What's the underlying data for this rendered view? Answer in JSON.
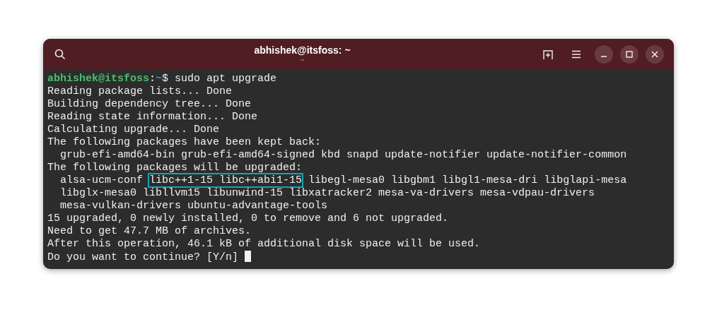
{
  "window": {
    "title": "abhishek@itsfoss: ~",
    "subtitle": "~"
  },
  "terminal": {
    "lines": [
      [
        {
          "kind": "user",
          "text": "abhishek@itsfoss"
        },
        {
          "kind": "text",
          "text": ":"
        },
        {
          "kind": "path",
          "text": "~"
        },
        {
          "kind": "text",
          "text": "$ sudo apt upgrade"
        }
      ],
      [
        {
          "kind": "text",
          "text": "Reading package lists... Done"
        }
      ],
      [
        {
          "kind": "text",
          "text": "Building dependency tree... Done"
        }
      ],
      [
        {
          "kind": "text",
          "text": "Reading state information... Done"
        }
      ],
      [
        {
          "kind": "text",
          "text": "Calculating upgrade... Done"
        }
      ],
      [
        {
          "kind": "text",
          "text": "The following packages have been kept back:"
        }
      ],
      [
        {
          "kind": "text",
          "text": "  grub-efi-amd64-bin grub-efi-amd64-signed kbd snapd update-notifier update-notifier-common"
        }
      ],
      [
        {
          "kind": "text",
          "text": "The following packages will be upgraded:"
        }
      ],
      [
        {
          "kind": "text",
          "text": "  alsa-ucm-conf "
        },
        {
          "kind": "highlight",
          "text": "libc++1-15 libc++abi1-15"
        },
        {
          "kind": "text",
          "text": " libegl-mesa0 libgbm1 libgl1-mesa-dri libglapi-mesa"
        }
      ],
      [
        {
          "kind": "text",
          "text": "  libglx-mesa0 libllvm15 libunwind-15 libxatracker2 mesa-va-drivers mesa-vdpau-drivers"
        }
      ],
      [
        {
          "kind": "text",
          "text": "  mesa-vulkan-drivers ubuntu-advantage-tools"
        }
      ],
      [
        {
          "kind": "text",
          "text": "15 upgraded, 0 newly installed, 0 to remove and 6 not upgraded."
        }
      ],
      [
        {
          "kind": "text",
          "text": "Need to get 47.7 MB of archives."
        }
      ],
      [
        {
          "kind": "text",
          "text": "After this operation, 46.1 kB of additional disk space will be used."
        }
      ],
      [
        {
          "kind": "text",
          "text": "Do you want to continue? [Y/n] "
        },
        {
          "kind": "cursor"
        }
      ]
    ]
  }
}
